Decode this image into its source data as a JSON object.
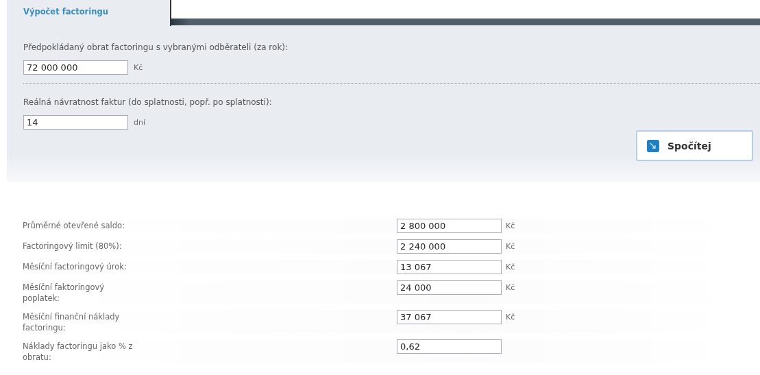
{
  "tabs": [
    {
      "label": "Výpočet factoringu",
      "selected": true
    }
  ],
  "inputs": [
    {
      "label": "Předpokládaný obrat factoringu s vybranými odběrateli (za rok):",
      "value": "72 000 000",
      "unit": "Kč"
    },
    {
      "label": "Reálná návratnost faktur (do splatnosti, popř. po splatnosti):",
      "value": "14",
      "unit": "dní"
    }
  ],
  "calculate_button": {
    "label": "Spočítej"
  },
  "results": [
    {
      "label": "Průměrné otevřené saldo:",
      "value": "2 800 000",
      "unit": "Kč"
    },
    {
      "label": "Factoringový limit (80%):",
      "value": "2 240 000",
      "unit": "Kč"
    },
    {
      "label": "Měsíční factoringový úrok:",
      "value": "13 067",
      "unit": "Kč"
    },
    {
      "label": "Měsíční faktoringový poplatek:",
      "value": "24 000",
      "unit": "Kč"
    },
    {
      "label": "Měsíční finanční náklady factoringu:",
      "value": "37 067",
      "unit": "Kč"
    },
    {
      "label": "Náklady factoringu jako % z obratu:",
      "value": "0,62"
    }
  ]
}
